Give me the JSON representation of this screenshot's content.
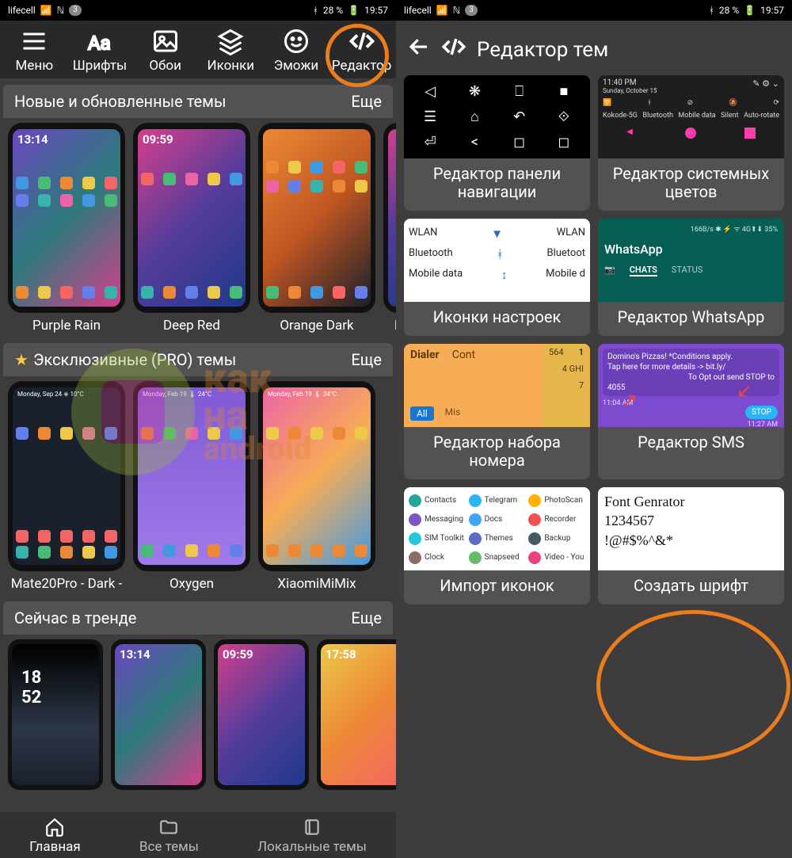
{
  "status": {
    "carrier": "lifecell",
    "notif_count": "3",
    "battery": "28 %",
    "time": "19:57"
  },
  "left": {
    "toolbar": {
      "menu": "Меню",
      "fonts": "Шрифты",
      "wallpapers": "Обои",
      "icons": "Иконки",
      "emoji": "Эможи",
      "editor": "Редактор"
    },
    "sections": {
      "new": {
        "title": "Новые и обновленные темы",
        "more": "Еще"
      },
      "pro": {
        "title": "Эксклюзивные (PRO) темы",
        "more": "Еще"
      },
      "trend": {
        "title": "Сейчас в тренде",
        "more": "Еще"
      }
    },
    "themes_new": [
      {
        "name": "Purple Rain",
        "clock": "13:14"
      },
      {
        "name": "Deep Red",
        "clock": "09:59"
      },
      {
        "name": "Orange Dark",
        "clock": ""
      },
      {
        "name": "H",
        "clock": ""
      }
    ],
    "themes_pro": [
      {
        "name": "Mate20Pro - Dark -",
        "clock": "Monday, Sep 24  ⎈ 10°C"
      },
      {
        "name": "Oxygen",
        "clock": "Monday, Feb 19  🌡 24°C"
      },
      {
        "name": "XiaomiMiMix",
        "clock": "Monday, Feb 19  🌡 24°C"
      }
    ],
    "themes_trend": [
      {
        "clock": "18\n52"
      },
      {
        "clock": "13:14"
      },
      {
        "clock": "09:59"
      },
      {
        "clock": "17:58"
      }
    ],
    "bottomnav": {
      "home": "Главная",
      "all": "Все темы",
      "local": "Локальные темы"
    }
  },
  "right": {
    "title": "Редактор тем",
    "cards": {
      "nav": "Редактор панели навигации",
      "syscolor": "Редактор системных цветов",
      "settings": "Иконки настроек",
      "whatsapp": "Редактор WhatsApp",
      "dialer": "Редактор набора номера",
      "sms": "Редактор SMS",
      "iconimport": "Импорт иконок",
      "font": "Создать шрифт"
    },
    "thumb_syscolor": {
      "time": "11:40 PM",
      "date": "Sunday, October 15",
      "qs": [
        "Kokode-5G",
        "Bluetooth",
        "Mobile data",
        "Silent",
        "Auto-rotate"
      ]
    },
    "thumb_settings": {
      "rows": [
        [
          "WLAN",
          "WLAN"
        ],
        [
          "Bluetooth",
          "Bluetoot"
        ],
        [
          "Mobile data",
          "Mobile d"
        ]
      ]
    },
    "thumb_whatsapp": {
      "status": "166B/s ✱ ⚡ ᯤ 4G⬆⬇ 35%",
      "title": "WhatsApp",
      "tabs": [
        "CHATS",
        "STATUS"
      ]
    },
    "thumb_dialer": {
      "tabs": [
        "Dialer",
        "Cont"
      ],
      "keypad": [
        [
          "564",
          "1"
        ],
        [
          "",
          "4 GHI"
        ],
        [
          "",
          "7"
        ]
      ],
      "sub": [
        "All",
        "Mis"
      ]
    },
    "thumb_sms": {
      "l1": "Domino's Pizzas!  *Conditions apply.",
      "l2": "Tap here for more details -> bit.ly/",
      "l3": "To Opt out send STOP to",
      "l4": "4055",
      "t1": "11:04 AM",
      "t2": "11:27 AM",
      "stop": "STOP"
    },
    "thumb_icons": [
      [
        "Contacts",
        "#26a69a"
      ],
      [
        "Telegram",
        "#29b6f6"
      ],
      [
        "PhotoScan",
        "#ffb300"
      ],
      [
        "Messaging",
        "#7e57c2"
      ],
      [
        "Docs",
        "#42a5f5"
      ],
      [
        "Recorder",
        "#ef5350"
      ],
      [
        "SIM Toolkit",
        "#26c6da"
      ],
      [
        "Themes",
        "#5c6bc0"
      ],
      [
        "Backup",
        "#455a64"
      ],
      [
        "Clock",
        "#8d6e63"
      ],
      [
        "Snapseed",
        "#66bb6a"
      ],
      [
        "Video - You",
        "#ec407a"
      ]
    ],
    "thumb_font": {
      "l1": "Font Genrator",
      "l2": "1234567",
      "l3": "!@#$%^&*"
    }
  }
}
